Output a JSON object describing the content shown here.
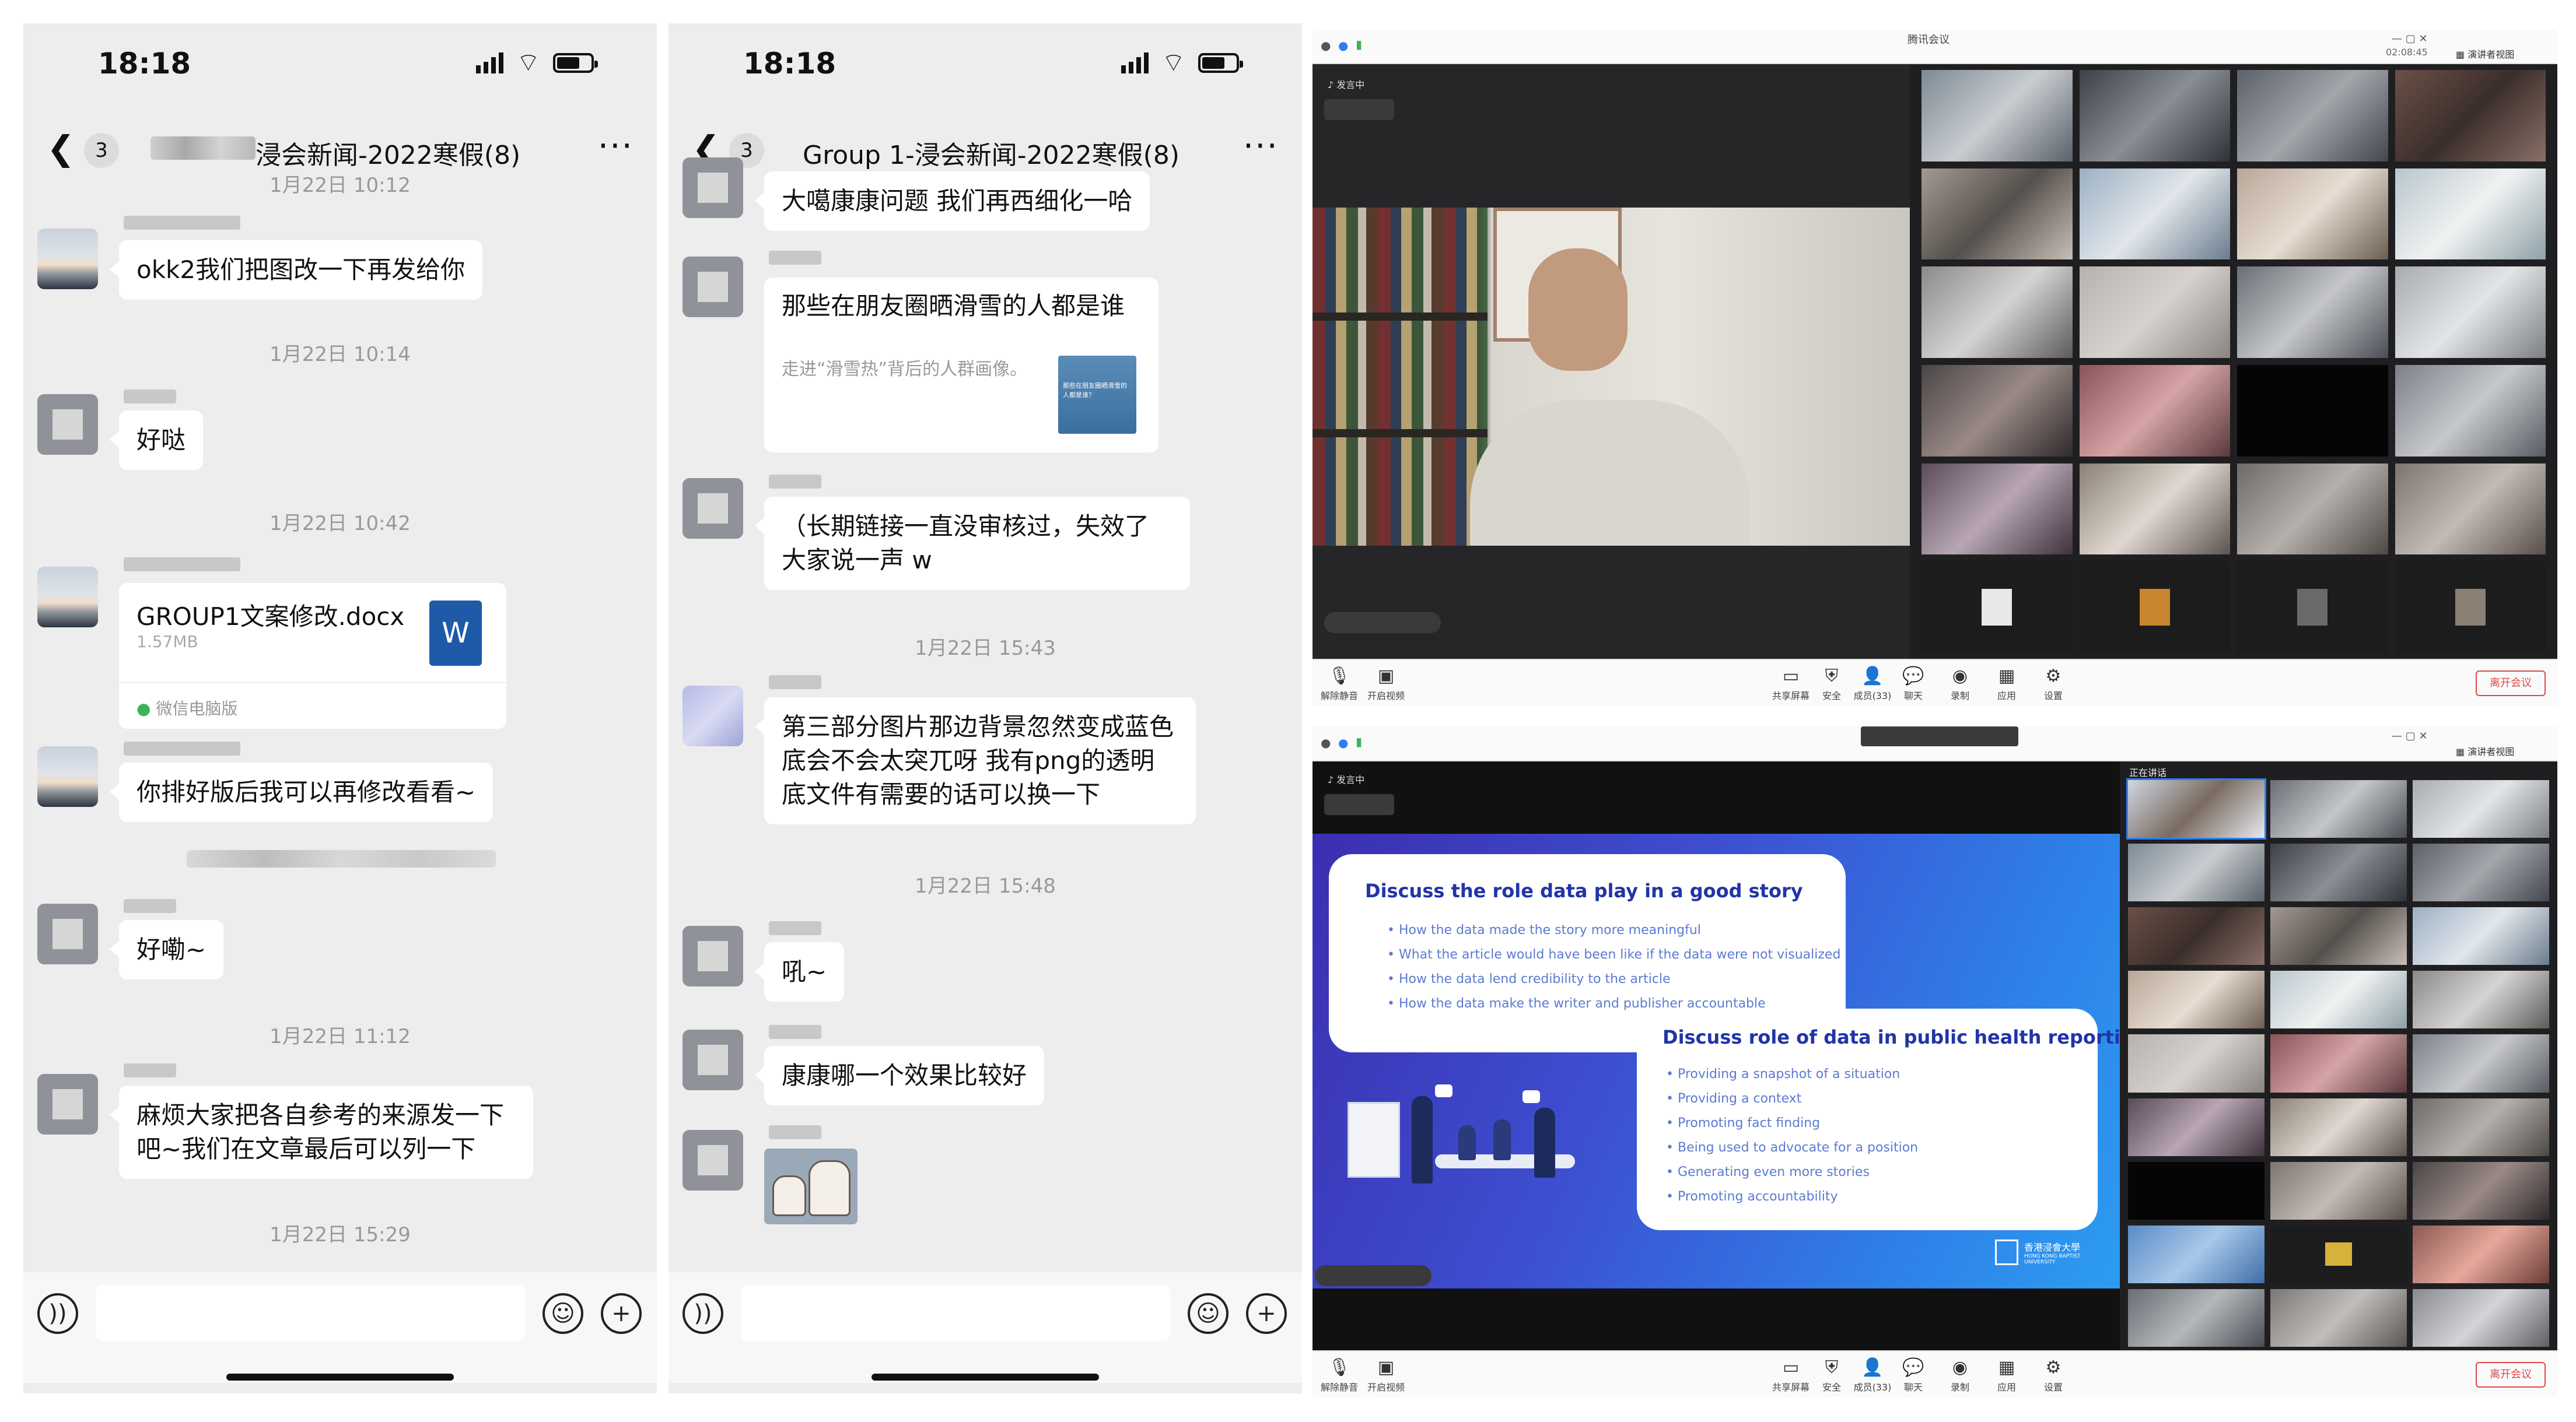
{
  "phone1": {
    "status": {
      "time": "18:18"
    },
    "nav": {
      "back_count": "3",
      "title": "浸会新闻-2022寒假(8)"
    },
    "messages": {
      "ts1": "1月22日 10:12",
      "m1": "okk2我们把图改一下再发给你",
      "ts2": "1月22日 10:14",
      "m2": "好哒",
      "ts3": "1月22日 10:42",
      "file_name": "GROUP1文案修改.docx",
      "file_size": "1.57MB",
      "file_source": "微信电脑版",
      "file_badge": "W",
      "m3": "你排好版后我可以再修改看看~",
      "m4": "好嘞~",
      "ts4": "1月22日 11:12",
      "m5": "麻烦大家把各自参考的来源发一下吧~我们在文章最后可以列一下",
      "ts5": "1月22日 15:29"
    }
  },
  "phone2": {
    "status": {
      "time": "18:18"
    },
    "nav": {
      "back_count": "3",
      "title": "Group 1-浸会新闻-2022寒假(8)"
    },
    "messages": {
      "m1": "大噶康康问题 我们再西细化一哈",
      "link_title": "那些在朋友圈晒滑雪的人都是谁",
      "link_desc": "走进“滑雪热”背后的人群画像。",
      "link_thumb_text": "那些在朋友圈晒滑雪的人都是谁？",
      "m2": "（长期链接一直没审核过，失效了大家说一声 w",
      "ts1": "1月22日 15:43",
      "m3": "第三部分图片那边背景忽然变成蓝色底会不会太突兀呀 我有png的透明底文件有需要的话可以换一下",
      "ts2": "1月22日 15:48",
      "m4": "吼~",
      "m5": "康康哪一个效果比较好"
    }
  },
  "meeting1": {
    "title": "腾讯会议",
    "timer": "02:08:45",
    "view_label": "演讲者视图",
    "speaking_label": "发言中",
    "toolbar": {
      "mute": "解除静音",
      "video": "开启视频",
      "share": "共享屏幕",
      "security": "安全",
      "members": "成员(33)",
      "chat": "聊天",
      "record": "录制",
      "apps": "应用",
      "settings": "设置",
      "leave": "离开会议"
    }
  },
  "meeting2": {
    "view_label": "演讲者视图",
    "presenting_label": "正在讲话",
    "speaking_label": "发言中",
    "toolbar": {
      "mute": "解除静音",
      "video": "开启视频",
      "share": "共享屏幕",
      "security": "安全",
      "members": "成员(33)",
      "chat": "聊天",
      "record": "录制",
      "apps": "应用",
      "settings": "设置",
      "leave": "离开会议"
    },
    "slide": {
      "heading1": "Discuss the role data play in a good story",
      "points1": [
        "How the data made the story more meaningful",
        "What the article would have been like if the data were not visualized",
        "How the data lend credibility to the article",
        "How the data make the writer and publisher accountable"
      ],
      "heading2": "Discuss role of data in public health reporting",
      "points2": [
        "Providing a snapshot of a situation",
        "Providing a context",
        "Promoting fact finding",
        "Being used to advocate for a position",
        "Generating even more stories",
        "Promoting accountability"
      ],
      "logo_cn": "香港浸會大學",
      "logo_en": "HONG KONG BAPTIST UNIVERSITY"
    }
  },
  "colors": {
    "chat_bg": "#ededed",
    "bubble": "#ffffff",
    "meeting_dark": "#1c1c1e",
    "slide_heading": "#2234a8",
    "leave_red": "#e04848",
    "word_blue": "#1f5aa8"
  }
}
